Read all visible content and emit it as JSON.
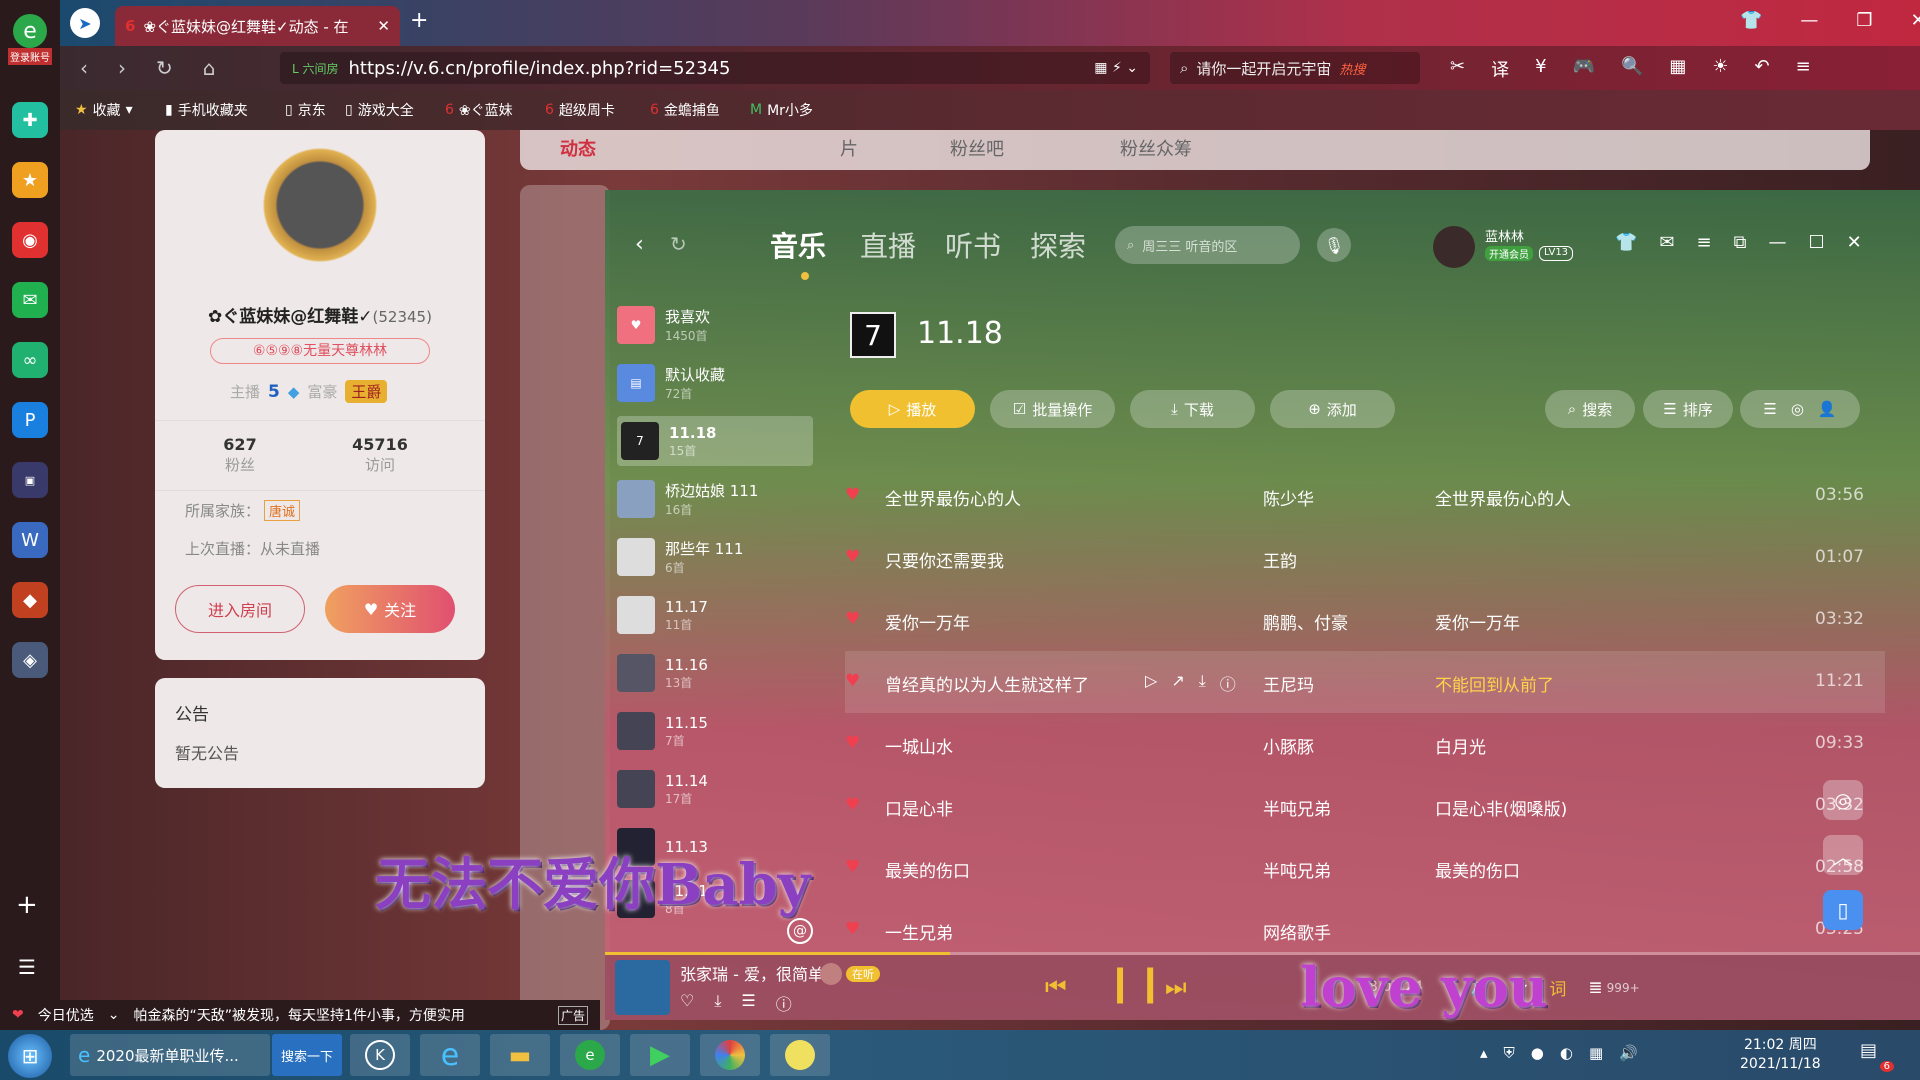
{
  "browser": {
    "logo_label": "登录账号",
    "tab_title": "❀ぐ蓝妹妹@红舞鞋✓动态 - 在",
    "url_prefix": "L 六间房",
    "url": "https://v.6.cn/profile/index.php?rid=52345",
    "search_placeholder": "请你一起开启元宇宙",
    "search_badge": "热搜",
    "bookmarks": [
      "收藏",
      "手机收藏夹",
      "京东",
      "游戏大全",
      "❀ぐ蓝妹",
      "超级周卡",
      "金蟾捕鱼",
      "Mr小多"
    ]
  },
  "profile": {
    "name": "✿ぐ蓝妹妹@红舞鞋✓",
    "rid": "(52345)",
    "title_badge": "⑥⑤⑨⑧无量天尊林林",
    "anchor_label": "主播",
    "anchor_level": "5",
    "rich_label": "富豪",
    "rich_badge": "王爵",
    "fans_count": "627",
    "fans_label": "粉丝",
    "visits_count": "45716",
    "visits_label": "访问",
    "family_label": "所属家族：",
    "family_value": "唐诚",
    "last_live": "上次直播：从未直播",
    "enter_room": "进入房间",
    "follow": "关注"
  },
  "notice": {
    "title": "公告",
    "content": "暂无公告"
  },
  "page_tabs": [
    "动态",
    "片",
    "粉丝吧",
    "粉丝众筹"
  ],
  "music": {
    "nav": [
      "音乐",
      "直播",
      "听书",
      "探索"
    ],
    "search_placeholder": "周三三 听音的区",
    "user_name": "蓝林林",
    "vip_badge": "开通会员",
    "level_badge": "LV13",
    "playlists": [
      {
        "name": "我喜欢",
        "count": "1450首"
      },
      {
        "name": "默认收藏",
        "count": "72首"
      },
      {
        "name": "11.18",
        "count": "15首"
      },
      {
        "name": "桥边姑娘 111",
        "count": "16首"
      },
      {
        "name": "那些年 111",
        "count": "6首"
      },
      {
        "name": "11.17",
        "count": "11首"
      },
      {
        "name": "11.16",
        "count": "13首"
      },
      {
        "name": "11.15",
        "count": "7首"
      },
      {
        "name": "11.14",
        "count": "17首"
      },
      {
        "name": "11.13",
        "count": ""
      },
      {
        "name": "11.11",
        "count": "8首"
      }
    ],
    "current_playlist": "11.18",
    "buttons": {
      "play": "播放",
      "batch": "批量操作",
      "download": "下载",
      "add": "添加",
      "search": "搜索",
      "sort": "排序"
    },
    "songs": [
      {
        "title": "全世界最伤心的人",
        "artist": "陈少华",
        "album": "全世界最伤心的人",
        "duration": "03:56"
      },
      {
        "title": "只要你还需要我",
        "artist": "王韵",
        "album": "",
        "duration": "01:07"
      },
      {
        "title": "爱你一万年",
        "artist": "鹏鹏、付豪",
        "album": "爱你一万年",
        "duration": "03:32"
      },
      {
        "title": "曾经真的以为人生就这样了",
        "artist": "王尼玛",
        "album": "不能回到从前了",
        "duration": "11:21"
      },
      {
        "title": "一城山水",
        "artist": "小豚豚",
        "album": "白月光",
        "duration": "09:33"
      },
      {
        "title": "口是心非",
        "artist": "半吨兄弟",
        "album": "口是心非(烟嗓版)",
        "duration": "03:32"
      },
      {
        "title": "最美的伤口",
        "artist": "半吨兄弟",
        "album": "最美的伤口",
        "duration": "02:58"
      },
      {
        "title": "一生兄弟",
        "artist": "网络歌手",
        "album": "",
        "duration": "03:25"
      }
    ],
    "now_playing": "张家瑞 - 爱，很简单",
    "listening_badge": "在听",
    "time": "08/03:24",
    "count_badge": "999+",
    "lyric_word": "词",
    "lyric_overlay_left": "无法不爱你Baby",
    "lyric_overlay_right": "love you"
  },
  "news": {
    "label": "今日优选",
    "text": "帕金森的“天敌”被发现，每天坚持1件小事，方便实用",
    "ad": "广告"
  },
  "taskbar": {
    "ie_item": "2020最新单职业传...",
    "search_btn": "搜索一下",
    "clock_time": "21:02 周四",
    "clock_date": "2021/11/18",
    "notif_count": "6"
  },
  "colors": {
    "accent": "#f0c040",
    "highlight_album": "#ffd24a"
  }
}
